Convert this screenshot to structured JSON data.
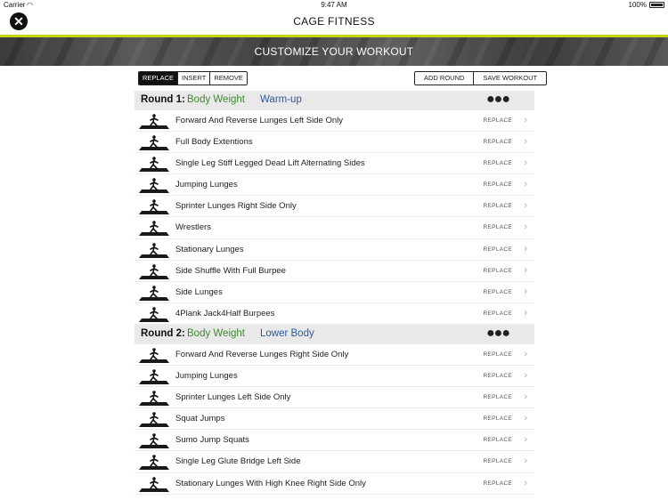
{
  "status": {
    "carrier": "Carrier",
    "wifi_icon": "wifi-icon",
    "time": "9:47 AM",
    "battery": "100%"
  },
  "nav": {
    "title": "CAGE FITNESS",
    "close_icon": "close-icon"
  },
  "colors": {
    "accent": "#c8d400",
    "round_category": "#3e8a2f",
    "round_type": "#2f5a9c",
    "header_bg": "#e9e9e9"
  },
  "banner": {
    "title": "CUSTOMIZE YOUR WORKOUT"
  },
  "toolbar": {
    "modes": [
      "REPLACE",
      "INSERT",
      "REMOVE"
    ],
    "active_mode": "REPLACE",
    "add_round": "ADD ROUND",
    "save_workout": "SAVE WORKOUT"
  },
  "rounds": [
    {
      "label": "Round 1:",
      "category": "Body Weight",
      "type": "Warm-up",
      "more_icon": "more-dots-icon",
      "exercises": [
        {
          "name": "Forward And Reverse Lunges Left Side Only",
          "action": "REPLACE"
        },
        {
          "name": "Full Body Extentions",
          "action": "REPLACE"
        },
        {
          "name": "Single Leg Stiff Legged Dead Lift Alternating Sides",
          "action": "REPLACE"
        },
        {
          "name": "Jumping Lunges",
          "action": "REPLACE"
        },
        {
          "name": "Sprinter Lunges Right Side Only",
          "action": "REPLACE"
        },
        {
          "name": "Wrestlers",
          "action": "REPLACE"
        },
        {
          "name": "Stationary Lunges",
          "action": "REPLACE"
        },
        {
          "name": "Side Shuffle With Full Burpee",
          "action": "REPLACE"
        },
        {
          "name": "Side Lunges",
          "action": "REPLACE"
        },
        {
          "name": "4Plank Jack4Half Burpees",
          "action": "REPLACE"
        }
      ]
    },
    {
      "label": "Round 2:",
      "category": "Body Weight",
      "type": "Lower Body",
      "more_icon": "more-dots-icon",
      "exercises": [
        {
          "name": "Forward And Reverse Lunges Right Side Only",
          "action": "REPLACE"
        },
        {
          "name": "Jumping Lunges",
          "action": "REPLACE"
        },
        {
          "name": "Sprinter Lunges Left Side Only",
          "action": "REPLACE"
        },
        {
          "name": "Squat Jumps",
          "action": "REPLACE"
        },
        {
          "name": "Sumo Jump Squats",
          "action": "REPLACE"
        },
        {
          "name": "Single Leg Glute Bridge Left Side",
          "action": "REPLACE"
        },
        {
          "name": "Stationary Lunges With High Knee Right Side Only",
          "action": "REPLACE"
        }
      ]
    }
  ]
}
